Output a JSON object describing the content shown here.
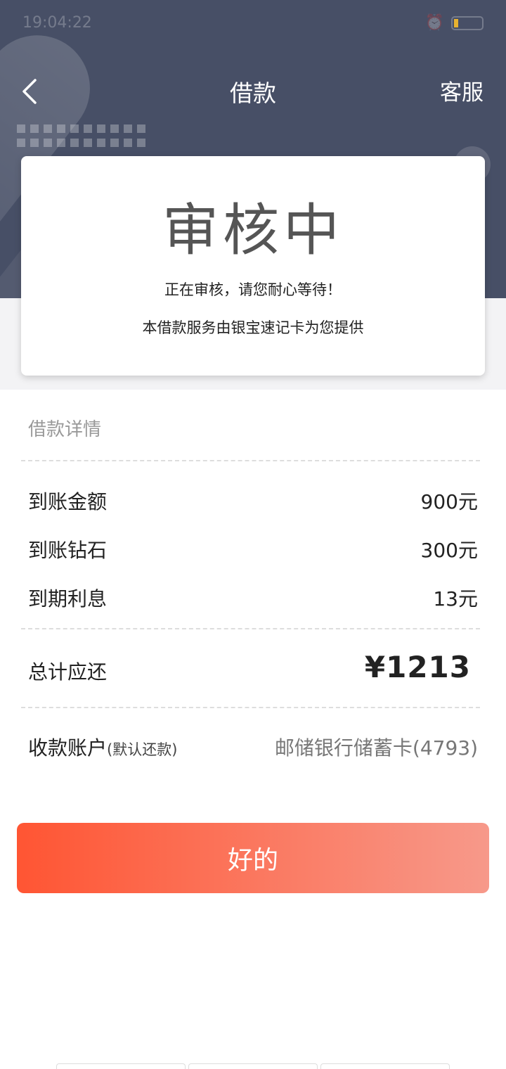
{
  "status_bar": {
    "time": "19:04:22"
  },
  "nav": {
    "title": "借款",
    "service_label": "客服"
  },
  "status_card": {
    "status": "审核中",
    "message": "正在审核，请您耐心等待！",
    "provider": "本借款服务由银宝速记卡为您提供"
  },
  "details": {
    "section_title": "借款详情",
    "rows": [
      {
        "label": "到账金额",
        "value": "900元"
      },
      {
        "label": "到账钻石",
        "value": "300元"
      },
      {
        "label": "到期利息",
        "value": "13元"
      }
    ],
    "total": {
      "label": "总计应还",
      "value": "¥1213"
    },
    "account": {
      "label": "收款账户",
      "note": "(默认还款)",
      "value": "邮储银行储蓄卡(4793)"
    }
  },
  "confirm_button": {
    "label": "好的"
  },
  "colors": {
    "header_bg": "#474f66",
    "button_start": "#ff5533",
    "button_end": "#f7998a"
  }
}
